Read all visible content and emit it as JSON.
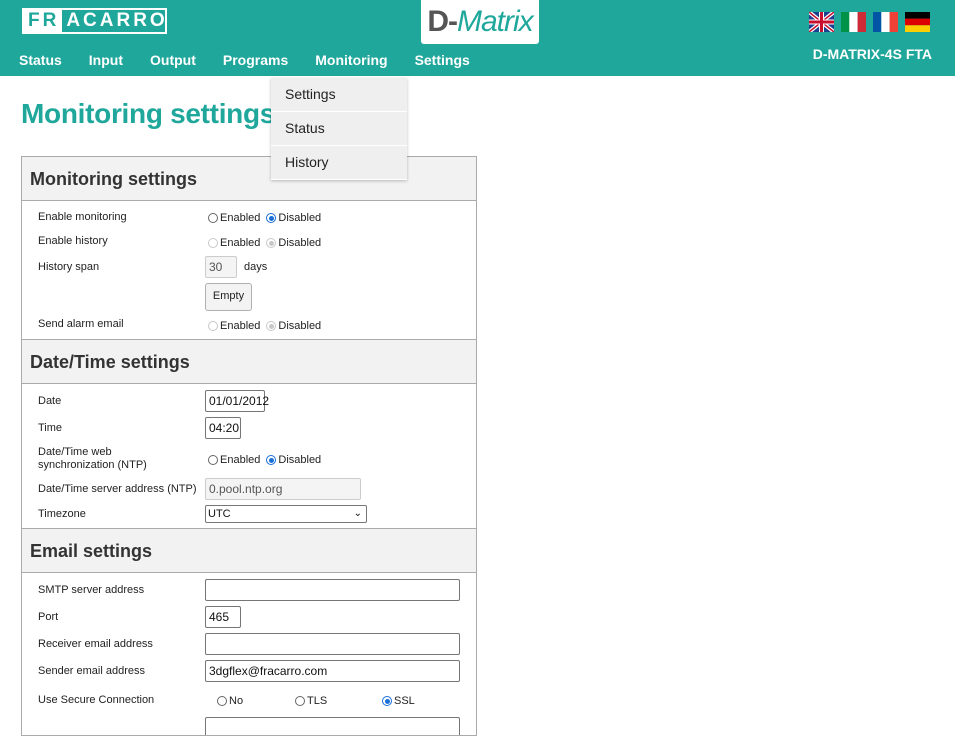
{
  "header": {
    "logo_part1": "FR",
    "logo_part2": "ACARRO",
    "brand_d": "D-",
    "brand_m": "Matrix",
    "model": "D-MATRIX-4S FTA",
    "nav": [
      "Status",
      "Input",
      "Output",
      "Programs",
      "Monitoring",
      "Settings"
    ],
    "flags": [
      "uk-flag-icon",
      "italy-flag-icon",
      "france-flag-icon",
      "germany-flag-icon"
    ]
  },
  "dropdown": [
    "Settings",
    "Status",
    "History"
  ],
  "page": {
    "title": "Monitoring settings"
  },
  "monitoring": {
    "heading": "Monitoring settings",
    "enable_monitoring": "Enable monitoring",
    "enable_history": "Enable history",
    "history_span": "History span",
    "history_span_value": "30",
    "days": "days",
    "empty_button": "Empty",
    "send_alarm_email": "Send alarm email",
    "enabled": "Enabled",
    "disabled": "Disabled"
  },
  "datetime": {
    "heading": "Date/Time settings",
    "date_label": "Date",
    "date_value": "01/01/2012",
    "time_label": "Time",
    "time_value": "04:20",
    "ntp_label": "Date/Time web synchronization (NTP)",
    "ntp_server_label": "Date/Time server address (NTP)",
    "ntp_server_value": "0.pool.ntp.org",
    "timezone_label": "Timezone",
    "timezone_value": "UTC",
    "enabled": "Enabled",
    "disabled": "Disabled"
  },
  "email": {
    "heading": "Email settings",
    "smtp_label": "SMTP server address",
    "smtp_value": "",
    "port_label": "Port",
    "port_value": "465",
    "receiver_label": "Receiver email address",
    "receiver_value": "",
    "sender_label": "Sender email address",
    "sender_value": "3dgflex@fracarro.com",
    "secure_label": "Use Secure Connection",
    "opt_no": "No",
    "opt_tls": "TLS",
    "opt_ssl": "SSL"
  },
  "colors": {
    "teal": "#1fa79b",
    "radio_checked": "#1a6fd8"
  }
}
